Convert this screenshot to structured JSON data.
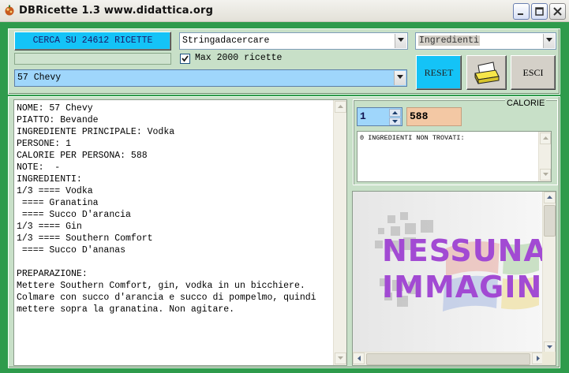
{
  "window": {
    "title": "DBRicette 1.3   www.didattica.org"
  },
  "toolbar": {
    "search_button": "CERCA SU 24612 RICETTE",
    "search_value": "Stringadacercare",
    "filter_value": "Ingredienti",
    "max_checkbox_label": "Max 2000 ricette",
    "max_checked": true,
    "recipe_selected": "57 Chevy",
    "reset_label": "RESET",
    "print_icon": "printer-icon",
    "exit_label": "ESCI"
  },
  "recipe": {
    "lines": [
      "NOME: 57 Chevy",
      "PIATTO: Bevande",
      "INGREDIENTE PRINCIPALE: Vodka",
      "PERSONE: 1",
      "CALORIE PER PERSONA: 588",
      "NOTE:  -",
      "INGREDIENTI:",
      "1/3 ==== Vodka",
      " ==== Granatina",
      " ==== Succo D'arancia",
      "1/3 ==== Gin",
      "1/3 ==== Southern Comfort",
      " ==== Succo D'ananas",
      "",
      "PREPARAZIONE:",
      "Mettere Southern Comfort, gin, vodka in un bicchiere.",
      "Colmare con succo d'arancia e succo di pompelmo, quindi",
      "mettere sopra la granatina. Non agitare."
    ]
  },
  "calorie": {
    "group_title": "CALORIE",
    "persone_value": "1",
    "calorie_value": "588",
    "missing_text": "0 INGREDIENTI NON TROVATI:"
  },
  "image": {
    "placeholder": "NESSUNA\nIMMAGINE"
  }
}
